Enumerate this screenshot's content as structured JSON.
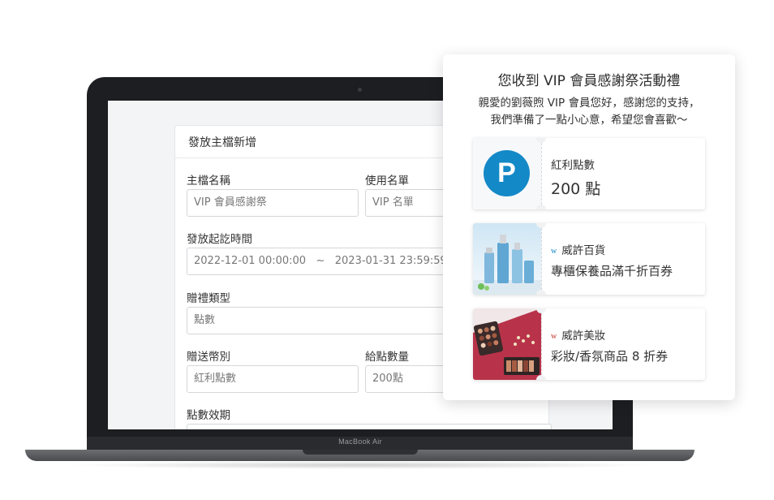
{
  "device": {
    "brand": "MacBook Air"
  },
  "form": {
    "title": "發放主檔新增",
    "name_label": "主檔名稱",
    "name_value": "VIP 會員感謝祭",
    "list_label": "使用名單",
    "list_value": "VIP 名單",
    "period_label": "發放起訖時間",
    "period_value": "2022-12-01 00:00:00   ~   2023-01-31 23:59:59",
    "gift_type_label": "贈禮類型",
    "gift_type_value": "點數",
    "currency_label": "贈送幣別",
    "currency_value": "紅利點數",
    "amount_label": "給點數量",
    "amount_value": "200點",
    "expiry_label": "點數效期"
  },
  "gift": {
    "title": "您收到 VIP 會員感謝祭活動禮",
    "subtitle_1": "親愛的劉薇煦 VIP 會員您好，感謝您的支持，",
    "subtitle_2": "我們準備了一點小心意，希望您會喜歡～",
    "coupons": [
      {
        "icon_letter": "P",
        "line1": "紅利點數",
        "line2": "200 點"
      },
      {
        "brand_mark": "w",
        "line1": "威許百貨",
        "line2": "專櫃保養品滿千折百券"
      },
      {
        "brand_mark": "w",
        "line1": "威許美妝",
        "line2": "彩妝/香氛商品 8 折券"
      }
    ]
  },
  "colors": {
    "accent": "#1389c7",
    "brand_mark_1": "#1389c7",
    "brand_mark_2": "#c0392b"
  }
}
